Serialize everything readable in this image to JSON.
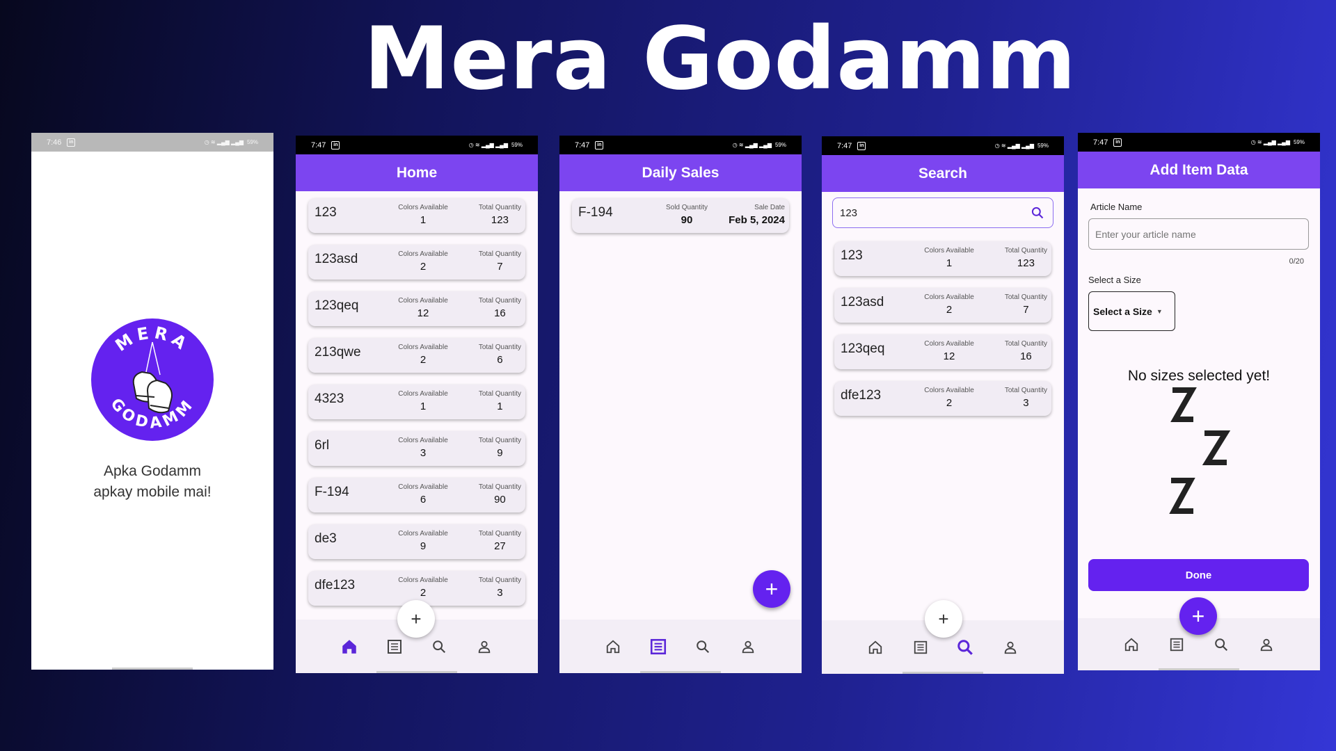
{
  "headline": "Mera Godamm",
  "splash": {
    "time": "7:46",
    "status": "59%",
    "logo_text_top": "MERA",
    "logo_text_bottom": "GODAMM",
    "tagline_line1": "Apka Godamm",
    "tagline_line2": "apkay mobile mai!"
  },
  "home": {
    "time": "7:47",
    "status": "59%",
    "title": "Home",
    "colors_label": "Colors Available",
    "total_label": "Total Quantity",
    "items": [
      {
        "name": "123",
        "colors": "1",
        "total": "123"
      },
      {
        "name": "123asd",
        "colors": "2",
        "total": "7"
      },
      {
        "name": "123qeq",
        "colors": "12",
        "total": "16"
      },
      {
        "name": "213qwe",
        "colors": "2",
        "total": "6"
      },
      {
        "name": "4323",
        "colors": "1",
        "total": "1"
      },
      {
        "name": "6rl",
        "colors": "3",
        "total": "9"
      },
      {
        "name": "F-194",
        "colors": "6",
        "total": "90"
      },
      {
        "name": "de3",
        "colors": "9",
        "total": "27"
      },
      {
        "name": "dfe123",
        "colors": "2",
        "total": "3"
      }
    ],
    "fab": "+"
  },
  "sales": {
    "time": "7:47",
    "status": "59%",
    "title": "Daily Sales",
    "sold_label": "Sold Quantity",
    "date_label": "Sale Date",
    "items": [
      {
        "name": "F-194",
        "sold": "90",
        "date": "Feb 5, 2024"
      }
    ],
    "fab": "+"
  },
  "search": {
    "time": "7:47",
    "status": "59%",
    "title": "Search",
    "query": "123",
    "colors_label": "Colors Available",
    "total_label": "Total Quantity",
    "items": [
      {
        "name": "123",
        "colors": "1",
        "total": "123"
      },
      {
        "name": "123asd",
        "colors": "2",
        "total": "7"
      },
      {
        "name": "123qeq",
        "colors": "12",
        "total": "16"
      },
      {
        "name": "dfe123",
        "colors": "2",
        "total": "3"
      }
    ],
    "fab": "+"
  },
  "add": {
    "time": "7:47",
    "status": "59%",
    "title": "Add Item Data",
    "article_label": "Article Name",
    "article_placeholder": "Enter your article name",
    "counter": "0/20",
    "size_label": "Select a Size",
    "size_select": "Select a Size",
    "empty_text": "No sizes selected yet!",
    "done": "Done",
    "fab": "+"
  },
  "colors": {
    "accent": "#7c45f0",
    "fab": "#6422ef",
    "nav_active": "#5b26d9"
  }
}
